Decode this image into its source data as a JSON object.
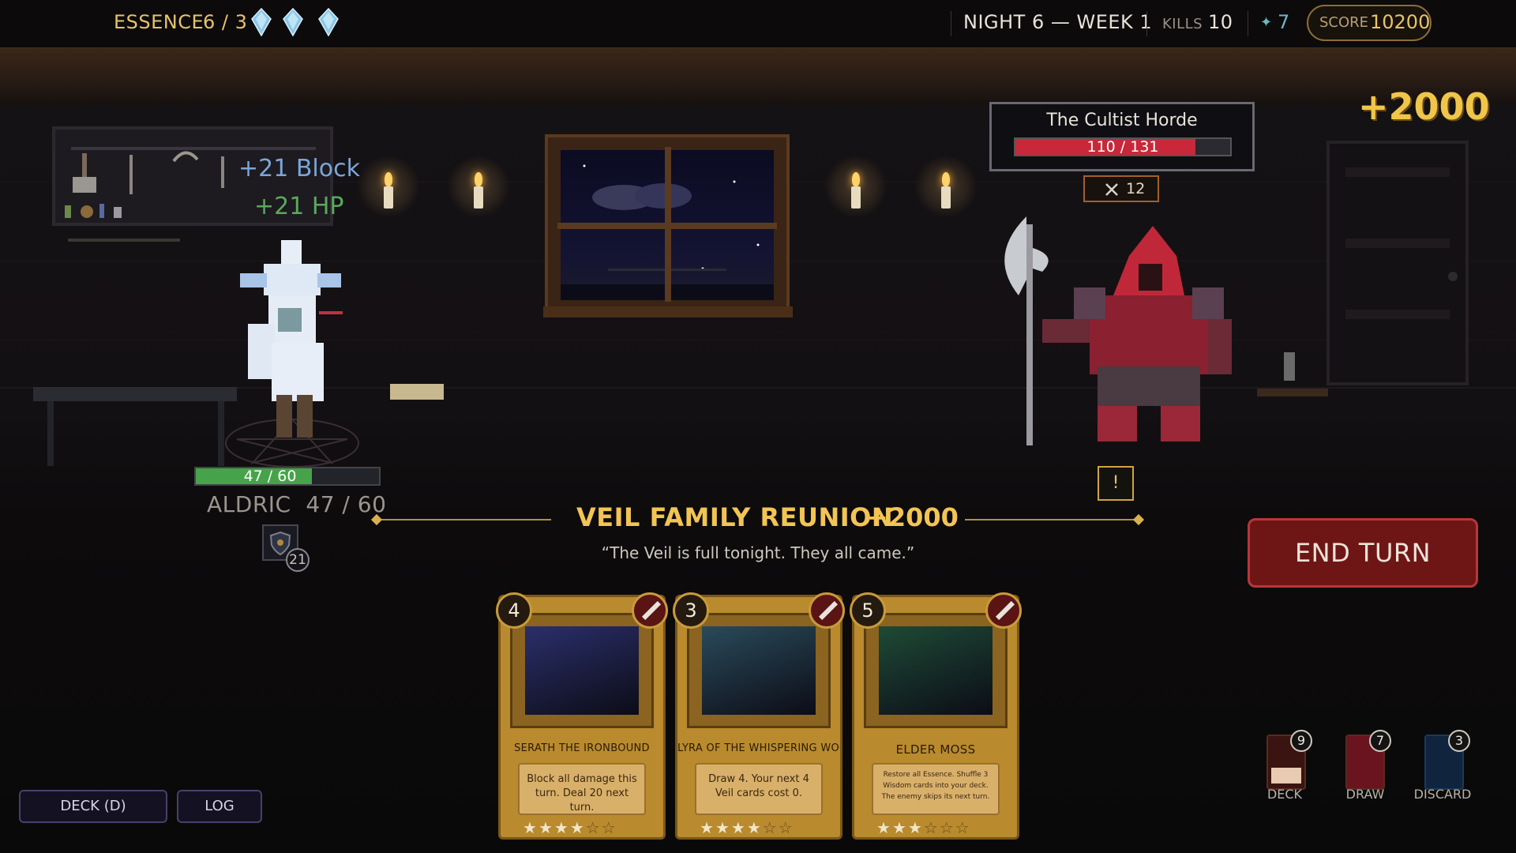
{
  "hud": {
    "essence_label": "ESSENCE",
    "essence_value": "6 / 3",
    "crystal_count": 3,
    "night": "NIGHT 6 — WEEK 1",
    "kills_label": "KILLS",
    "kills_value": "10",
    "gems_icon": "✦",
    "gems_value": "7",
    "score_label": "SCORE",
    "score_value": "10200"
  },
  "enemy": {
    "name": "The Cultist Horde",
    "hp_text": "110 / 131",
    "hp_fraction": 0.84,
    "intent_icon": "crossed-swords-icon",
    "intent_value": "12",
    "alert": "!"
  },
  "score_popup": "+2000",
  "player": {
    "name": "ALDRIC",
    "name_hp": "47 / 60",
    "hp_text": "47 / 60",
    "hp_fraction": 0.78,
    "block_value": "21",
    "float_block": "+21 Block",
    "float_hp": "+21 HP"
  },
  "event": {
    "title": "VEIL FAMILY REUNION",
    "score": "+2000",
    "quote": "“The Veil is full tonight. They all came.”"
  },
  "end_turn_label": "END TURN",
  "cards": [
    {
      "cost": "4",
      "name": "SERATH THE IRONBOUND",
      "desc": "Block all damage this turn. Deal 20 next turn.",
      "stars_on": 4,
      "art_color": "#2a2f6a"
    },
    {
      "cost": "3",
      "name": "LYRA OF THE WHISPERING WOO",
      "desc": "Draw 4. Your next 4 Veil cards cost 0.",
      "stars_on": 4,
      "art_color": "#2a4a5a"
    },
    {
      "cost": "5",
      "name": "ELDER MOSS",
      "desc": "Restore all Essence. Shuffle 3 Wisdom cards into your deck. The enemy skips its next turn.",
      "stars_on": 3,
      "art_color": "#1e4a36"
    }
  ],
  "star_glyph": "★",
  "star_empty_glyph": "☆",
  "buttons": {
    "deck": "DECK (D)",
    "log": "LOG"
  },
  "piles": {
    "deck_label": "DECK",
    "deck_count": "9",
    "draw_label": "DRAW",
    "draw_count": "7",
    "discard_label": "DISCARD",
    "discard_count": "3"
  },
  "colors": {
    "gold": "#e7c36a",
    "enemy_hp": "#c8283a",
    "player_hp": "#46a34a",
    "end_turn": "#6e1616"
  }
}
